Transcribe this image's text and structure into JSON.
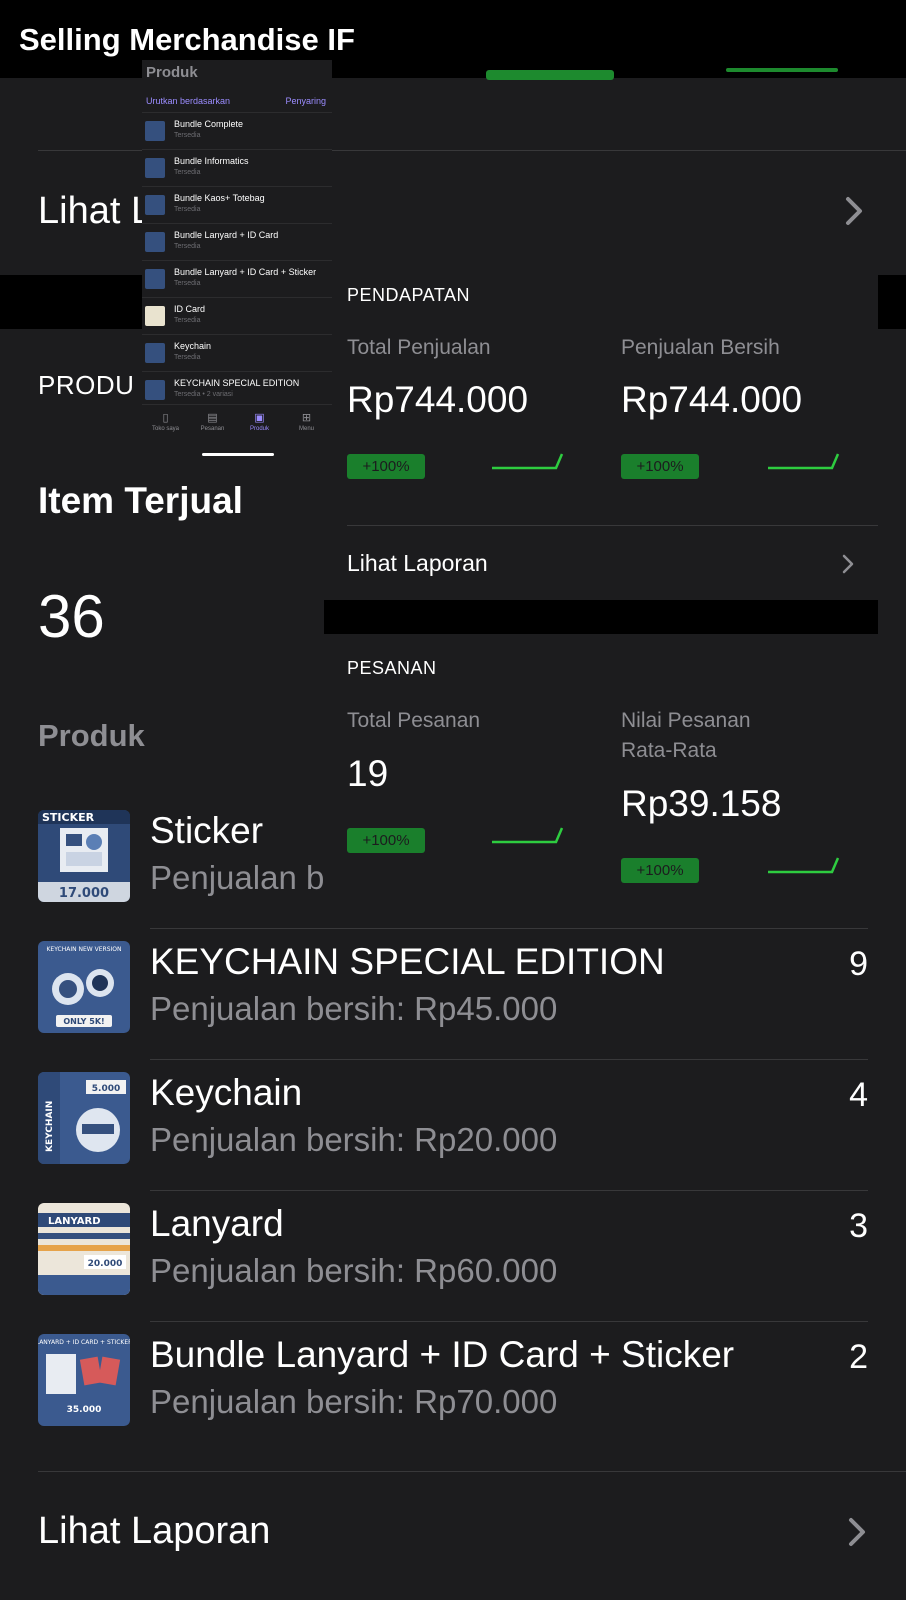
{
  "window_title": "Selling Merchandise IF",
  "background_link": "Lihat L",
  "produk_section_header": "PRODU",
  "items_sold": {
    "label": "Item Terjual",
    "value": "36"
  },
  "products_label": "Produk",
  "products": [
    {
      "name": "Sticker",
      "net_sales": "Penjualan b",
      "qty": "",
      "thumb_text": "17.000",
      "icon": "sticker-thumbnail"
    },
    {
      "name": "KEYCHAIN SPECIAL EDITION",
      "net_sales": "Penjualan bersih: Rp45.000",
      "qty": "9",
      "thumb_text": "ONLY 5K!",
      "icon": "keychain-special-thumbnail"
    },
    {
      "name": "Keychain",
      "net_sales": "Penjualan bersih: Rp20.000",
      "qty": "4",
      "thumb_text": "5.000",
      "icon": "keychain-thumbnail"
    },
    {
      "name": "Lanyard",
      "net_sales": "Penjualan bersih: Rp60.000",
      "qty": "3",
      "thumb_text": "20.000",
      "icon": "lanyard-thumbnail"
    },
    {
      "name": "Bundle Lanyard + ID Card + Sticker",
      "net_sales": "Penjualan bersih: Rp70.000",
      "qty": "2",
      "thumb_text": "35.000",
      "icon": "bundle-thumbnail"
    }
  ],
  "view_report": "Lihat Laporan",
  "mini_list": {
    "title": "Produk",
    "sort_label": "Urutkan berdasarkan",
    "filter_label": "Penyaring",
    "items": [
      {
        "name": "Bundle Complete",
        "status": "Tersedia"
      },
      {
        "name": "Bundle Informatics",
        "status": "Tersedia"
      },
      {
        "name": "Bundle Kaos+ Totebag",
        "status": "Tersedia"
      },
      {
        "name": "Bundle Lanyard + ID Card",
        "status": "Tersedia"
      },
      {
        "name": "Bundle Lanyard + ID Card + Sticker",
        "status": "Tersedia"
      },
      {
        "name": "ID Card",
        "status": "Tersedia"
      },
      {
        "name": "Keychain",
        "status": "Tersedia"
      },
      {
        "name": "KEYCHAIN SPECIAL EDITION",
        "status": "Tersedia • 2 variasi"
      }
    ],
    "tabs": [
      {
        "label": "Toko saya",
        "icon": "bar-chart-icon"
      },
      {
        "label": "Pesanan",
        "icon": "orders-icon"
      },
      {
        "label": "Produk",
        "icon": "box-icon",
        "active": true
      },
      {
        "label": "Menu",
        "icon": "grid-icon"
      }
    ]
  },
  "analytics": {
    "revenue": {
      "title": "PENDAPATAN",
      "total_sales": {
        "label": "Total Penjualan",
        "value": "Rp744.000",
        "change": "+100%"
      },
      "net_sales": {
        "label": "Penjualan Bersih",
        "value": "Rp744.000",
        "change": "+100%"
      },
      "view_report": "Lihat Laporan"
    },
    "orders": {
      "title": "PESANAN",
      "total_orders": {
        "label": "Total Pesanan",
        "value": "19",
        "change": "+100%"
      },
      "avg_order": {
        "label_line1": "Nilai Pesanan",
        "label_line2": "Rata-Rata",
        "value": "Rp39.158",
        "change": "+100%"
      }
    }
  },
  "colors": {
    "background": "#1c1c1e",
    "secondary_text": "#8e8e93",
    "separator": "#38383a",
    "badge_green": "#1a7f2c",
    "spark_green": "#2ecc40",
    "accent_purple": "#9b8cff",
    "thumb_blue": "#35507e"
  }
}
